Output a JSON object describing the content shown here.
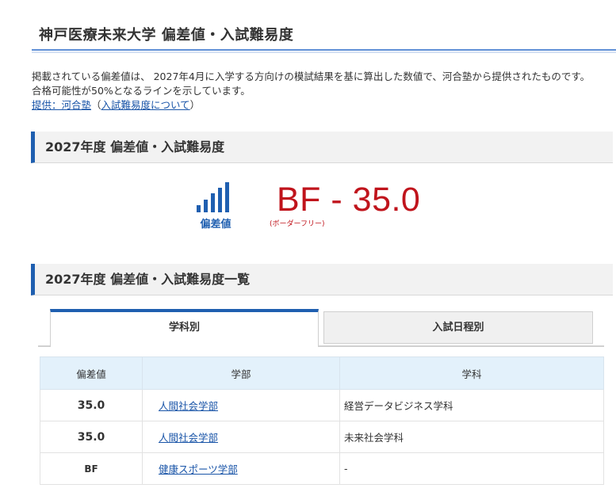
{
  "page_title": "神戸医療未来大学 偏差値・入試難易度",
  "intro": {
    "line1": "掲載されている偏差値は、 2027年4月に入学する方向けの模試結果を基に算出した数値で、河合塾から提供されたものです。",
    "line2": "合格可能性が50%となるラインを示しています。",
    "provider_link": "提供：河合塾",
    "paren_open": "（",
    "about_link": "入試難易度について",
    "paren_close": "）"
  },
  "section1": {
    "title": "2027年度 偏差値・入試難易度"
  },
  "score": {
    "label": "偏差値",
    "value": "BF - 35.0",
    "note": "(ボーダーフリー)"
  },
  "section2": {
    "title": "2027年度 偏差値・入試難易度一覧"
  },
  "tabs": [
    {
      "label": "学科別",
      "active": true
    },
    {
      "label": "入試日程別",
      "active": false
    }
  ],
  "table": {
    "headers": [
      "偏差値",
      "学部",
      "学科"
    ],
    "rows": [
      {
        "score": "35.0",
        "faculty": "人間社会学部",
        "department": "経営データビジネス学科"
      },
      {
        "score": "35.0",
        "faculty": "人間社会学部",
        "department": "未来社会学科"
      },
      {
        "score": "BF",
        "faculty": "健康スポーツ学部",
        "department": "-"
      }
    ]
  },
  "colors": {
    "accent": "#1f5fb0",
    "score_red": "#c0141c",
    "link": "#1a55a8"
  }
}
